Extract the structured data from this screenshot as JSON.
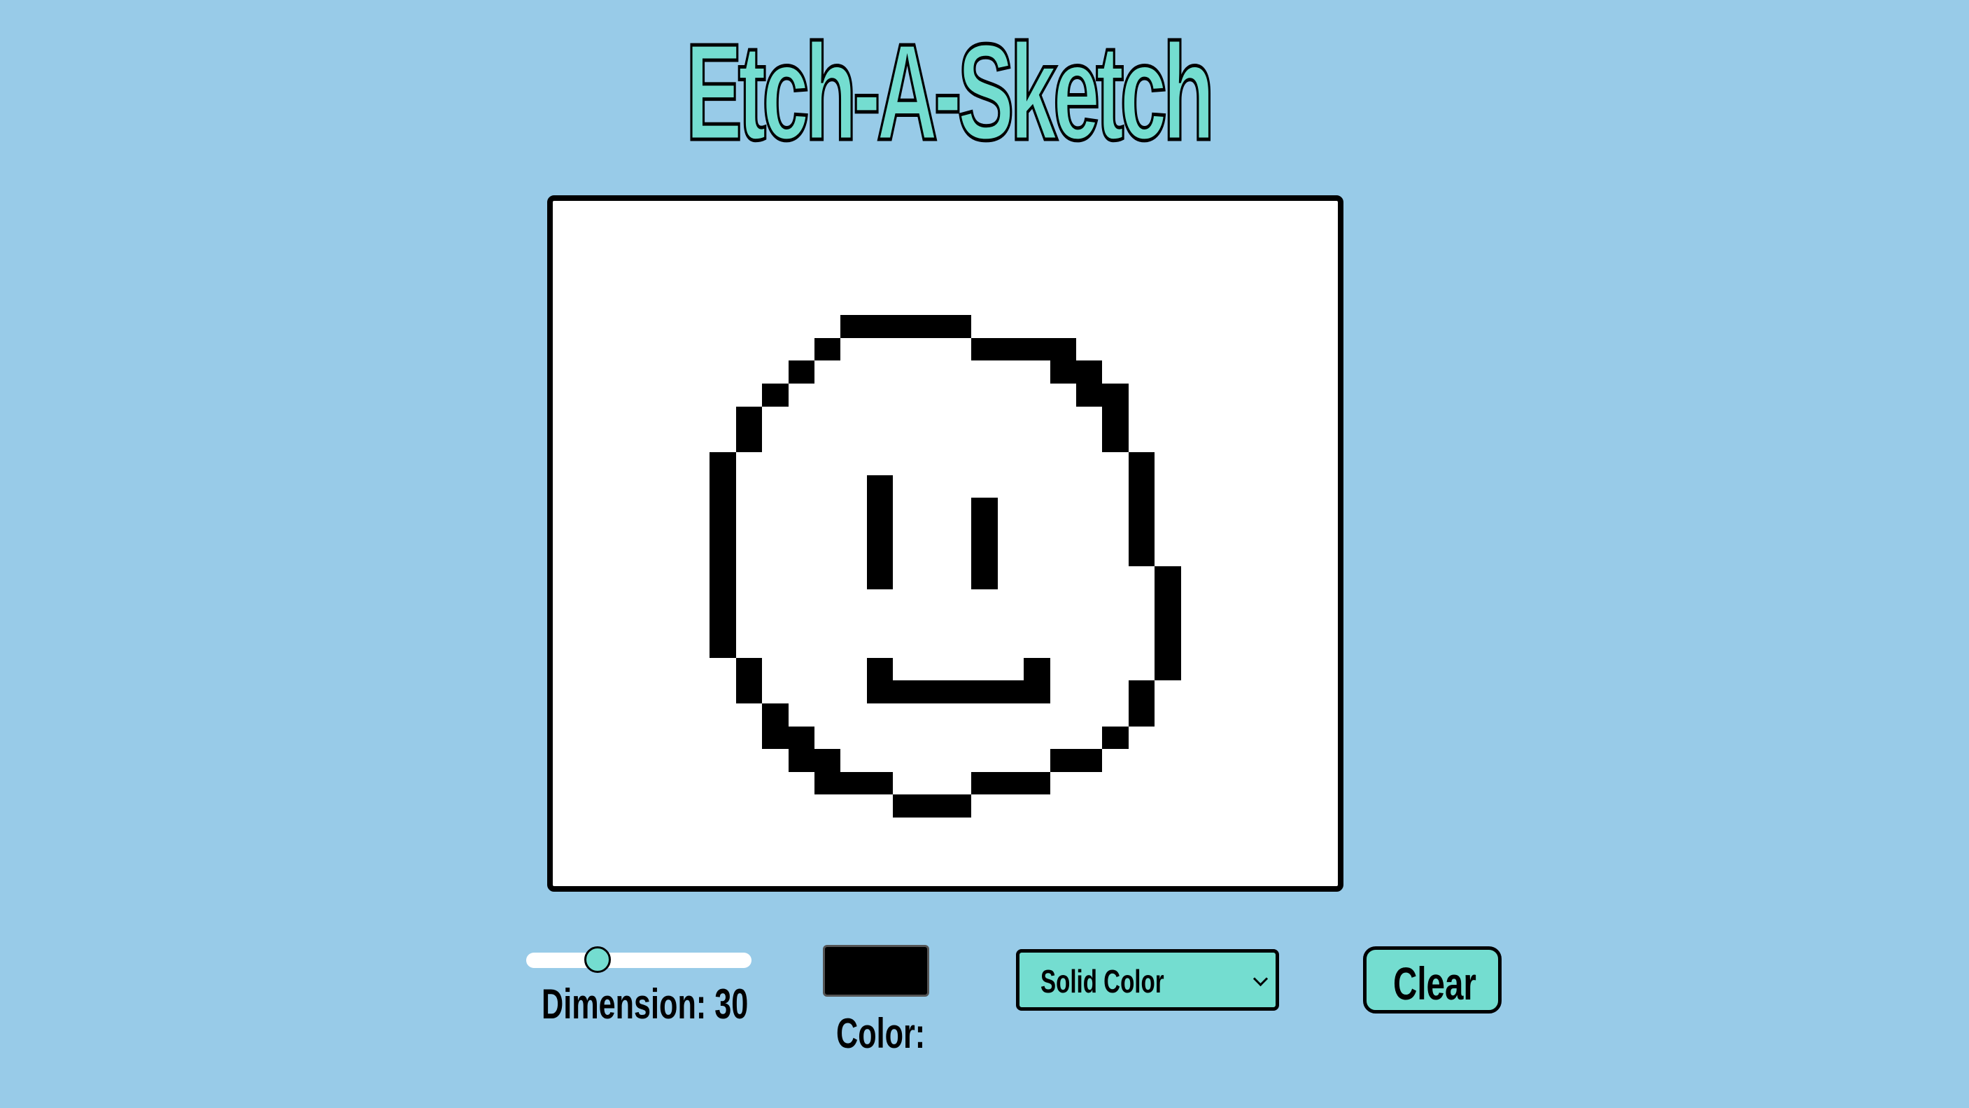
{
  "title": "Etch-A-Sketch",
  "board": {
    "dimension": 30,
    "pen_color": "#000000",
    "background_color": "#ffffff",
    "filled_cells": [
      [
        5,
        11
      ],
      [
        5,
        12
      ],
      [
        5,
        13
      ],
      [
        5,
        14
      ],
      [
        5,
        15
      ],
      [
        6,
        10
      ],
      [
        6,
        16
      ],
      [
        6,
        17
      ],
      [
        6,
        18
      ],
      [
        6,
        19
      ],
      [
        7,
        9
      ],
      [
        7,
        19
      ],
      [
        7,
        20
      ],
      [
        8,
        8
      ],
      [
        8,
        20
      ],
      [
        8,
        21
      ],
      [
        9,
        7
      ],
      [
        9,
        21
      ],
      [
        10,
        7
      ],
      [
        10,
        21
      ],
      [
        11,
        6
      ],
      [
        11,
        22
      ],
      [
        12,
        6
      ],
      [
        12,
        12
      ],
      [
        12,
        22
      ],
      [
        13,
        6
      ],
      [
        13,
        12
      ],
      [
        13,
        16
      ],
      [
        13,
        22
      ],
      [
        14,
        6
      ],
      [
        14,
        12
      ],
      [
        14,
        16
      ],
      [
        14,
        22
      ],
      [
        15,
        6
      ],
      [
        15,
        12
      ],
      [
        15,
        16
      ],
      [
        15,
        22
      ],
      [
        16,
        6
      ],
      [
        16,
        12
      ],
      [
        16,
        16
      ],
      [
        16,
        23
      ],
      [
        17,
        6
      ],
      [
        17,
        23
      ],
      [
        18,
        6
      ],
      [
        18,
        23
      ],
      [
        19,
        6
      ],
      [
        19,
        23
      ],
      [
        20,
        7
      ],
      [
        20,
        12
      ],
      [
        20,
        18
      ],
      [
        20,
        23
      ],
      [
        21,
        7
      ],
      [
        21,
        12
      ],
      [
        21,
        13
      ],
      [
        21,
        14
      ],
      [
        21,
        15
      ],
      [
        21,
        16
      ],
      [
        21,
        17
      ],
      [
        21,
        18
      ],
      [
        21,
        22
      ],
      [
        22,
        8
      ],
      [
        22,
        22
      ],
      [
        23,
        8
      ],
      [
        23,
        9
      ],
      [
        23,
        21
      ],
      [
        24,
        9
      ],
      [
        24,
        10
      ],
      [
        24,
        19
      ],
      [
        24,
        20
      ],
      [
        25,
        10
      ],
      [
        25,
        11
      ],
      [
        25,
        12
      ],
      [
        25,
        16
      ],
      [
        25,
        17
      ],
      [
        25,
        18
      ],
      [
        26,
        13
      ],
      [
        26,
        14
      ],
      [
        26,
        15
      ]
    ]
  },
  "controls": {
    "dimension_label": "Dimension: 30",
    "dimension_value": 30,
    "dimension_min": 1,
    "dimension_max": 100,
    "color_label": "Color:",
    "mode_selected": "Solid Color",
    "clear_label": "Clear"
  },
  "colors": {
    "page_background": "#98cbe8",
    "accent": "#74ddd0",
    "outline": "#000000"
  }
}
